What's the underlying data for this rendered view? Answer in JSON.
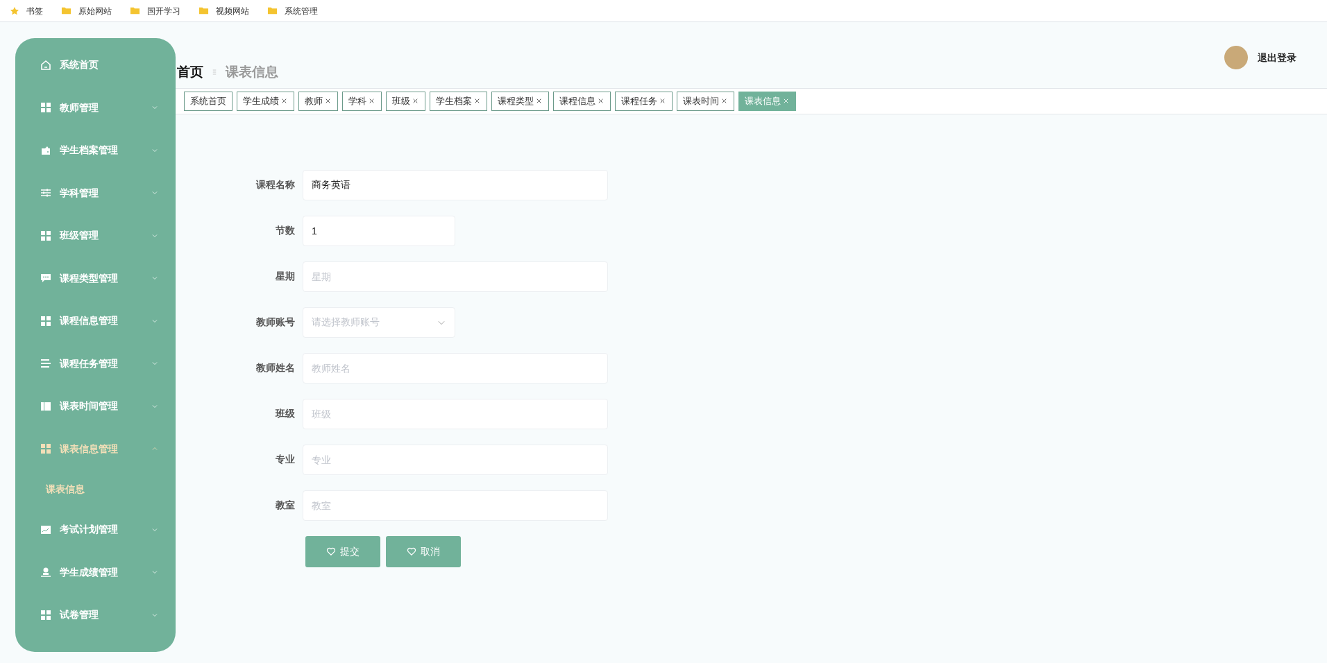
{
  "bookmarks_bar": [
    {
      "label": "书签",
      "kind": "star"
    },
    {
      "label": "原始网站",
      "kind": "folder"
    },
    {
      "label": "国开学习",
      "kind": "folder"
    },
    {
      "label": "视频网站",
      "kind": "folder"
    },
    {
      "label": "系统管理",
      "kind": "folder"
    }
  ],
  "sidebar": {
    "items": [
      {
        "label": "系统首页",
        "selected": false
      },
      {
        "label": "教师管理",
        "selected": false,
        "expanded": false
      },
      {
        "label": "学生档案管理",
        "selected": false,
        "expanded": false
      },
      {
        "label": "学科管理",
        "selected": false,
        "expanded": false
      },
      {
        "label": "班级管理",
        "selected": false,
        "expanded": false
      },
      {
        "label": "课程类型管理",
        "selected": false,
        "expanded": false
      },
      {
        "label": "课程信息管理",
        "selected": false,
        "expanded": false
      },
      {
        "label": "课程任务管理",
        "selected": false,
        "expanded": false
      },
      {
        "label": "课表时间管理",
        "selected": false,
        "expanded": false
      },
      {
        "label": "课表信息管理",
        "selected": true,
        "expanded": true,
        "children": [
          {
            "label": "课表信息",
            "selected": true
          }
        ]
      },
      {
        "label": "考试计划管理",
        "selected": false,
        "expanded": false
      },
      {
        "label": "学生成绩管理",
        "selected": false,
        "expanded": false
      },
      {
        "label": "试卷管理",
        "selected": false,
        "expanded": false
      }
    ]
  },
  "breadcrumb": [
    "首页",
    "课表信息"
  ],
  "header": {
    "logout": "退出登录"
  },
  "tabs": [
    {
      "label": "系统首页",
      "closable": false,
      "selected": false
    },
    {
      "label": "学生成绩",
      "closable": true,
      "selected": false
    },
    {
      "label": "教师",
      "closable": true,
      "selected": false
    },
    {
      "label": "学科",
      "closable": true,
      "selected": false
    },
    {
      "label": "班级",
      "closable": true,
      "selected": false
    },
    {
      "label": "学生档案",
      "closable": true,
      "selected": false
    },
    {
      "label": "课程类型",
      "closable": true,
      "selected": false
    },
    {
      "label": "课程信息",
      "closable": true,
      "selected": false
    },
    {
      "label": "课程任务",
      "closable": true,
      "selected": false
    },
    {
      "label": "课表时间",
      "closable": true,
      "selected": false
    },
    {
      "label": "课表信息",
      "closable": true,
      "selected": true
    }
  ],
  "form": {
    "fields": [
      {
        "label": "课程名称",
        "kind": "text",
        "value": "商务英语"
      },
      {
        "label": "节数",
        "kind": "number",
        "value": "1"
      },
      {
        "label": "星期",
        "kind": "text",
        "placeholder": "星期"
      },
      {
        "label": "教师账号",
        "kind": "select",
        "placeholder": "请选择教师账号"
      },
      {
        "label": "教师姓名",
        "kind": "text",
        "placeholder": "教师姓名"
      },
      {
        "label": "班级",
        "kind": "text",
        "placeholder": "班级"
      },
      {
        "label": "专业",
        "kind": "text",
        "placeholder": "专业"
      },
      {
        "label": "教室",
        "kind": "text",
        "placeholder": "教室"
      }
    ],
    "buttons": [
      "提交",
      "取消"
    ]
  }
}
